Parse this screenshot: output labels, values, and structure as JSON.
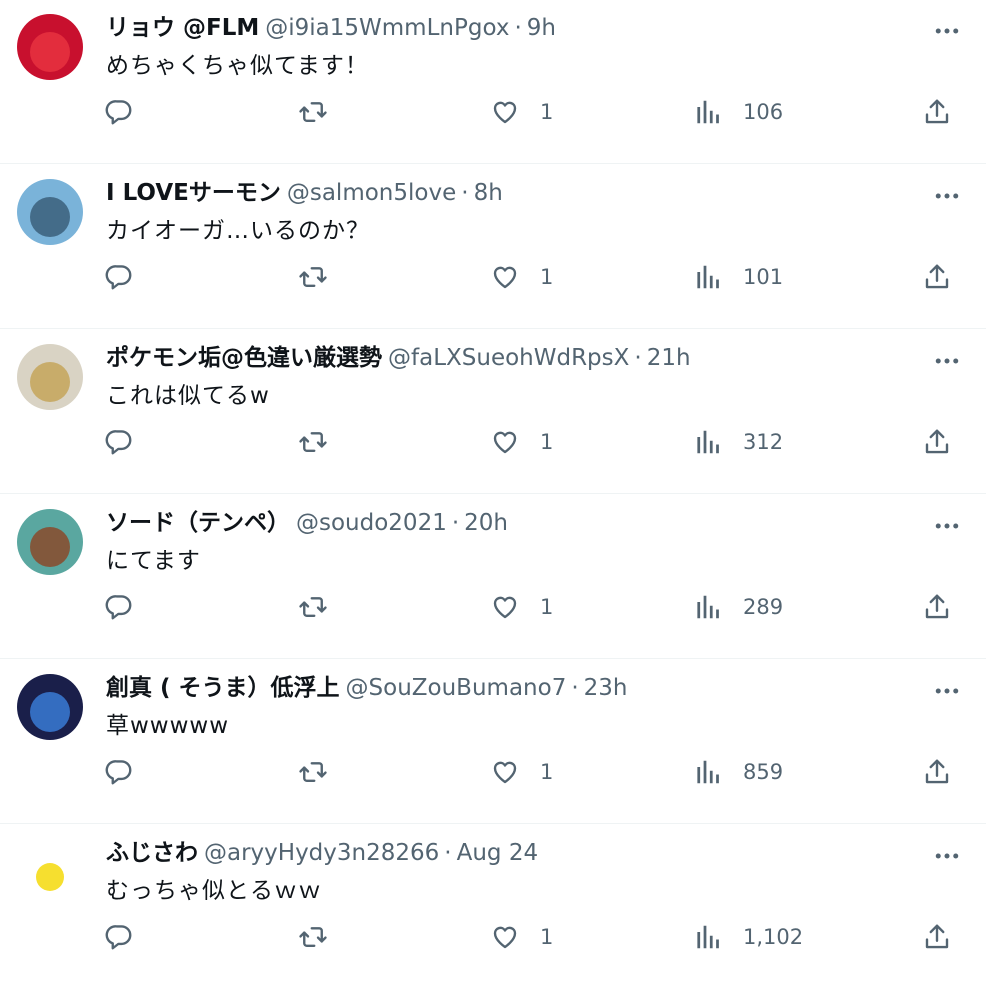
{
  "tweets": [
    {
      "name": "リョウ @FLM",
      "handle": "@i9ia15WmmLnPgox",
      "separator": "·",
      "time": "9h",
      "text": "めちゃくちゃ似てます！",
      "likes": "1",
      "views": "106",
      "avatar_colors": [
        "#c8102e",
        "#e8323f"
      ]
    },
    {
      "name": "I LOVEサーモン",
      "handle": "@salmon5love",
      "separator": "·",
      "time": "8h",
      "text": "カイオーガ…いるのか？",
      "likes": "1",
      "views": "101",
      "avatar_colors": [
        "#7ab3d9",
        "#3b5f7a"
      ]
    },
    {
      "name": "ポケモン垢@色違い厳選勢",
      "handle": "@faLXSueohWdRpsX",
      "separator": "·",
      "time": "21h",
      "text": "これは似てるw",
      "likes": "1",
      "views": "312",
      "avatar_colors": [
        "#d9d3c4",
        "#c4a55a"
      ]
    },
    {
      "name": "ソード（テンペ）",
      "handle": "@soudo2021",
      "separator": "·",
      "time": "20h",
      "text": "にてます",
      "likes": "1",
      "views": "289",
      "avatar_colors": [
        "#5aa7a0",
        "#8a4a2a"
      ]
    },
    {
      "name": "創真 ( そうま）低浮上",
      "handle": "@SouZouBumano7",
      "separator": "·",
      "time": "23h",
      "text": "草wwwww",
      "likes": "1",
      "views": "859",
      "avatar_colors": [
        "#1a1f4a",
        "#3a7bd5"
      ]
    },
    {
      "name": "ふじさわ",
      "handle": "@aryyHydy3n28266",
      "separator": "·",
      "time": "Aug 24",
      "text": "むっちゃ似とるｗｗ",
      "likes": "1",
      "views": "1,102",
      "avatar_colors": [
        "#ffffff",
        "#f5d90a"
      ]
    }
  ],
  "icons": {
    "reply": "reply-icon",
    "retweet": "retweet-icon",
    "like": "like-icon",
    "views": "views-icon",
    "share": "share-icon",
    "more": "more-icon"
  },
  "colors": {
    "text": "#0f1419",
    "secondary": "#536471",
    "divider": "#eff3f4"
  }
}
